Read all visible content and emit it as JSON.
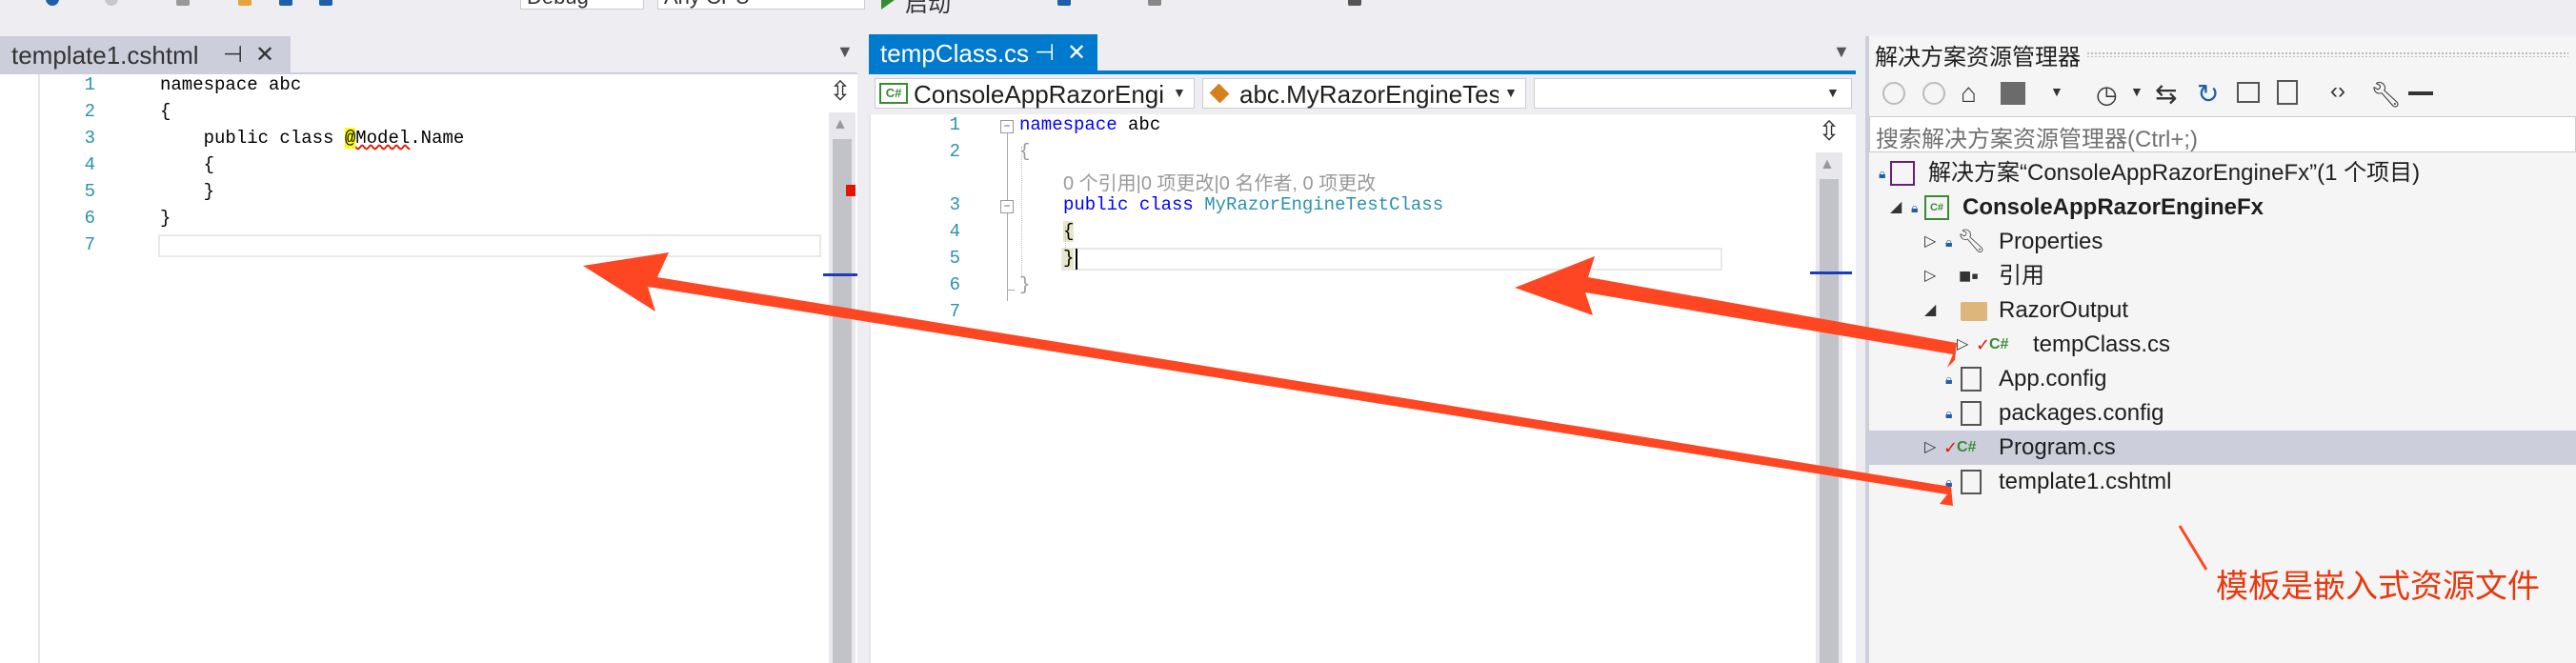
{
  "toolbar": {
    "config": "Debug",
    "platform": "Any CPU",
    "start_label": "启动"
  },
  "left_tab": {
    "title": "template1.cshtml",
    "pin": "⊣",
    "close": "✕"
  },
  "left_editor": {
    "line_numbers": [
      "1",
      "2",
      "3",
      "4",
      "5",
      "6",
      "7"
    ],
    "lines": [
      "namespace abc",
      "{",
      "    public class @Model.Name",
      "    {",
      "    }",
      "}",
      ""
    ],
    "razor_at": "@",
    "razor_model": "Model",
    "razor_rest": ".Name",
    "razor_prefix": "    public class "
  },
  "right_tab": {
    "title": "tempClass.cs",
    "pin": "⊣",
    "close": "✕"
  },
  "nav_bar": {
    "project_combo": "ConsoleAppRazorEngin",
    "class_combo": "abc.MyRazorEngineTest"
  },
  "right_editor": {
    "line_numbers": [
      "1",
      "2",
      "",
      "3",
      "4",
      "5",
      "6",
      "7"
    ],
    "ns_kw": "namespace",
    "ns_name": " abc",
    "brace_open": "{",
    "codelens": "0 个引用|0 项更改|0 名作者, 0 项更改",
    "public_kw": "public",
    "class_kw": "class",
    "class_name": "MyRazorEngineTestClass",
    "inner_open": "{",
    "inner_close": "}",
    "brace_close": "}"
  },
  "solution_explorer": {
    "title": "解决方案资源管理器",
    "search_placeholder": "搜索解决方案资源管理器(Ctrl+;)",
    "items": [
      {
        "label": "解决方案“ConsoleAppRazorEngineFx”(1 个项目)",
        "icon": "solution-icon"
      },
      {
        "label": "ConsoleAppRazorEngineFx",
        "icon": "csharp-project-icon"
      },
      {
        "label": "Properties",
        "icon": "wrench-icon"
      },
      {
        "label": "引用",
        "icon": "references-icon"
      },
      {
        "label": "RazorOutput",
        "icon": "folder-icon"
      },
      {
        "label": "tempClass.cs",
        "icon": "csharp-file-icon"
      },
      {
        "label": "App.config",
        "icon": "config-icon"
      },
      {
        "label": "packages.config",
        "icon": "config-icon"
      },
      {
        "label": "Program.cs",
        "icon": "csharp-file-icon"
      },
      {
        "label": "template1.cshtml",
        "icon": "cshtml-file-icon"
      }
    ]
  },
  "annotation": {
    "text": "模板是嵌入式资源文件"
  },
  "colors": {
    "accent": "#007acc",
    "arrow": "#ff4622",
    "annotation_text": "#e8380d",
    "selected_row": "#cce8ff"
  }
}
